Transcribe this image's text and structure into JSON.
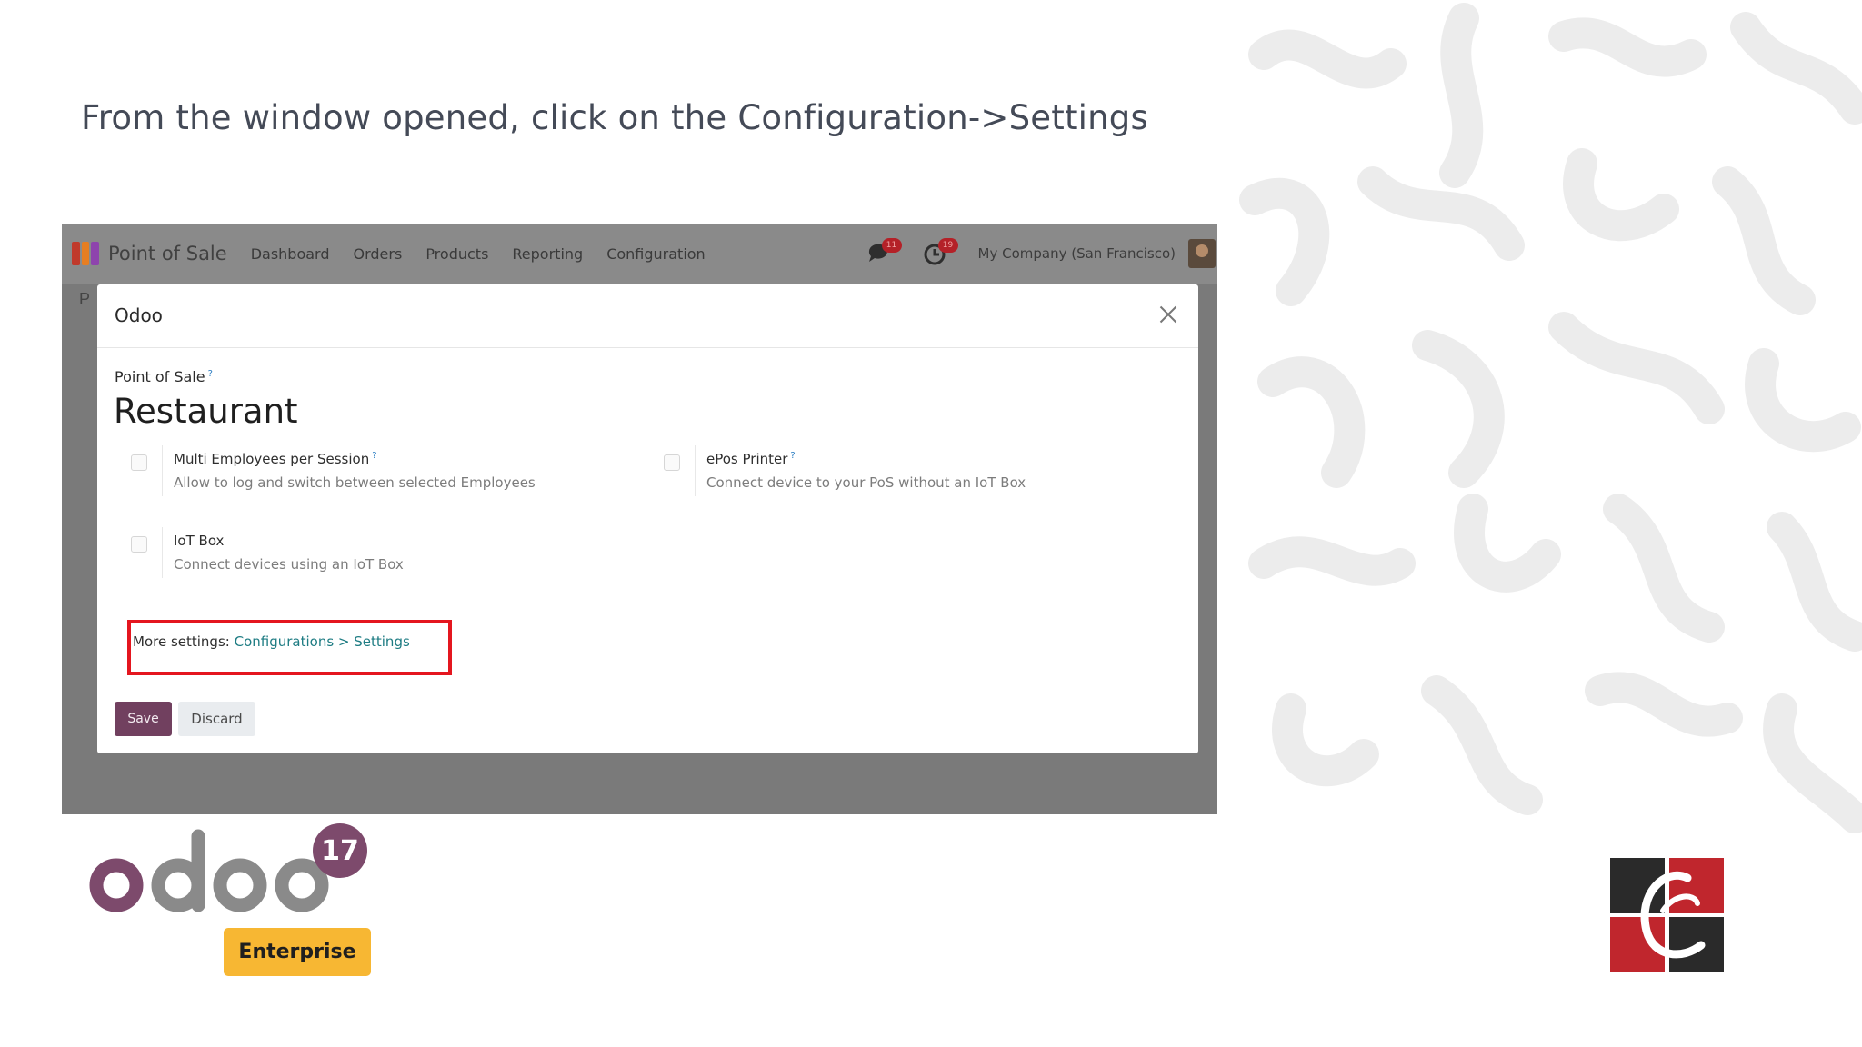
{
  "slide": {
    "heading": "From the window opened, click on the Configuration->Settings"
  },
  "app": {
    "title": "Point of Sale",
    "menu": [
      "Dashboard",
      "Orders",
      "Products",
      "Reporting",
      "Configuration"
    ],
    "messages_badge": "11",
    "activity_badge": "19",
    "company": "My Company (San Francisco)",
    "under_text": "P"
  },
  "modal": {
    "title": "Odoo",
    "pos_label": "Point of Sale",
    "pos_name": "Restaurant",
    "settings": [
      {
        "title": "Multi Employees per Session",
        "desc": "Allow to log and switch between selected Employees"
      },
      {
        "title": "ePos Printer",
        "desc": "Connect device to your PoS without an IoT Box"
      },
      {
        "title": "IoT Box",
        "desc": "Connect devices using an IoT Box"
      }
    ],
    "more_settings_label": "More settings:",
    "more_settings_link": "Configurations > Settings",
    "save_label": "Save",
    "discard_label": "Discard",
    "help_mark": "?"
  },
  "branding": {
    "logo_text": "odoo",
    "version": "17",
    "edition": "Enterprise"
  },
  "colors": {
    "odoo_purple": "#71405f",
    "highlight_red": "#e4161f",
    "link_teal": "#1e7c83",
    "enterprise_yellow": "#f7b733"
  }
}
